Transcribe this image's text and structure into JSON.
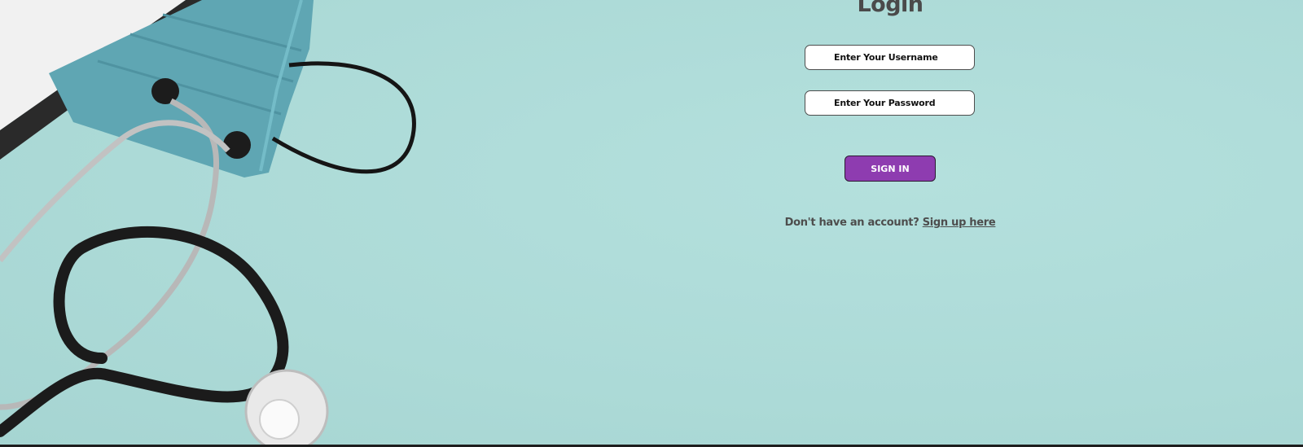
{
  "login": {
    "title": "Login",
    "username_placeholder": "Enter Your Username",
    "password_placeholder": "Enter Your Password",
    "submit_label": "SIGN IN",
    "signup_prompt": "Don't have an account?",
    "signup_link": "Sign up here"
  },
  "illustration": {
    "subject": "stethoscope-and-medical-mask"
  },
  "colors": {
    "background": "#b2dcda",
    "button": "#8e3cb0",
    "button_text": "#ffffff",
    "text": "#4a4a4a"
  }
}
